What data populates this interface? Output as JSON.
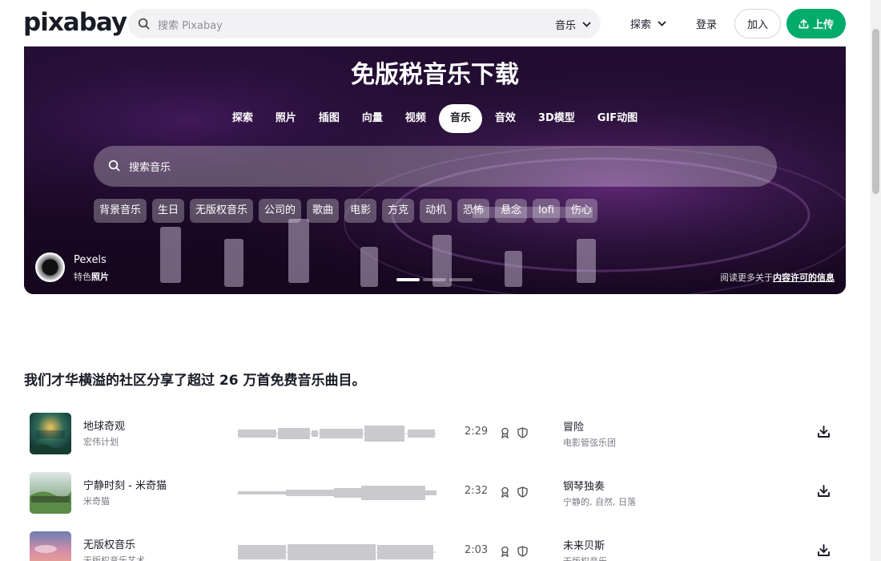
{
  "header": {
    "logo": "pixabay",
    "search_placeholder": "搜索 Pixabay",
    "search_category": "音乐",
    "nav_explore": "探索",
    "nav_login": "登录",
    "join_label": "加入",
    "upload_label": "上传"
  },
  "hero": {
    "title": "免版税音乐下载",
    "tabs": [
      "探索",
      "照片",
      "插图",
      "向量",
      "视频",
      "音乐",
      "音效",
      "3D模型",
      "GIF动图"
    ],
    "active_tab": "音乐",
    "search_placeholder": "搜索音乐",
    "chips": [
      "背景音乐",
      "生日",
      "无版权音乐",
      "公司的",
      "歌曲",
      "电影",
      "方克",
      "动机",
      "恐怖",
      "悬念",
      "lofi",
      "伤心"
    ],
    "credit_name": "Pexels",
    "credit_sub_prefix": "特色",
    "credit_sub_strong": "照片",
    "license_prefix": "阅读更多关于",
    "license_link": "内容许可的信息",
    "slides": 3,
    "active_slide": 1
  },
  "main": {
    "section_title": "我们才华横溢的社区分享了超过 26 万首免费音乐曲目。",
    "tracks": [
      {
        "title": "地球奇观",
        "artist": "宏伟计划",
        "duration": "2:29",
        "genre": "冒险",
        "tags": "电影管弦乐团"
      },
      {
        "title": "宁静时刻 - 米奇猫",
        "artist": "米奇猫",
        "duration": "2:32",
        "genre": "钢琴独奏",
        "tags": "宁静的, 自然, 日落"
      },
      {
        "title": "无版权音乐",
        "artist": "无版权音乐艺术",
        "duration": "2:03",
        "genre": "未来贝斯",
        "tags": "无版权音乐"
      }
    ]
  },
  "colors": {
    "brand_green": "#00ab6b",
    "text": "#191b26",
    "hero_bg": "#1e0b2d"
  }
}
